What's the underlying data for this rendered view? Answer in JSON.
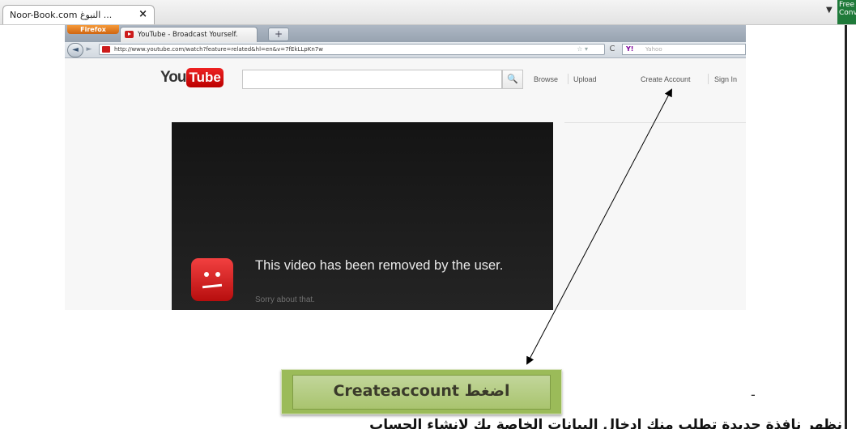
{
  "viewer": {
    "tab_title": "Noor-Book.com  النبوغ ...",
    "tab_close": "×",
    "dropdown_glyph": "▼",
    "badge_text": "Free P\nConve"
  },
  "browser": {
    "menu_button": "Firefox",
    "tab_title": "YouTube - Broadcast Yourself.",
    "new_tab": "+",
    "back": "◄",
    "forward": "►",
    "url": "http://www.youtube.com/watch?feature=related&hl=en&v=7fEkLLpKn7w",
    "bookmark_star": "☆ ▾",
    "reload": "C",
    "search_engine": "Y!",
    "search_placeholder": "Yahoo"
  },
  "youtube": {
    "logo_you": "You",
    "logo_tube": "Tube",
    "search_icon": "🔍",
    "browse": "Browse",
    "upload": "Upload",
    "create_account": "Create Account",
    "sign_in": "Sign In",
    "removed_message": "This video has been removed by the user.",
    "sorry": "Sorry about that."
  },
  "annotation": {
    "callout_text": "اضغط Createaccount",
    "dash": "-",
    "bottom_line": "نظهر نافذة جديدة تطلب منك ادخال البيانات الخاصة بك لإنشاء الحساب"
  },
  "colors": {
    "callout_bg": "#9bbb59",
    "youtube_red": "#cc1b1b",
    "player_bg": "#1c1c1c"
  }
}
